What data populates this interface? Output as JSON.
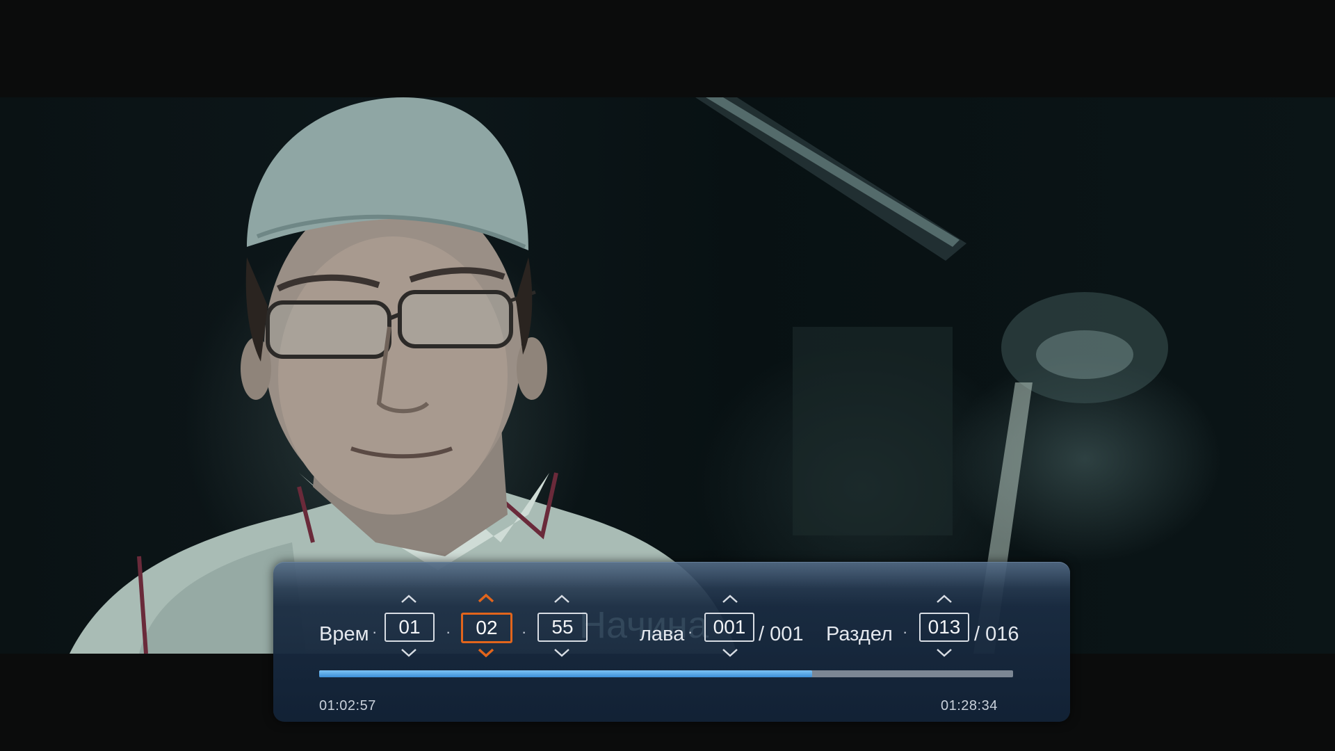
{
  "osd": {
    "ghost_text": "Начина",
    "time_label": "Врем",
    "separator": "·",
    "hours": "01",
    "minutes": "02",
    "seconds": "55",
    "chapter_label": "лава",
    "chapter_value": "001",
    "chapter_total": "/ 001",
    "section_label": "Раздел",
    "section_value": "013",
    "section_total": "/ 016",
    "current_time": "01:02:57",
    "total_time": "01:28:34",
    "progress_fraction": 0.71,
    "active_field": "minutes",
    "colors": {
      "accent_active": "#e2651c",
      "progress_fill": "#3c8fd6",
      "panel_bg": "#1a2c42"
    }
  },
  "icons": {
    "up": "chevron-up-icon",
    "down": "chevron-down-icon"
  }
}
